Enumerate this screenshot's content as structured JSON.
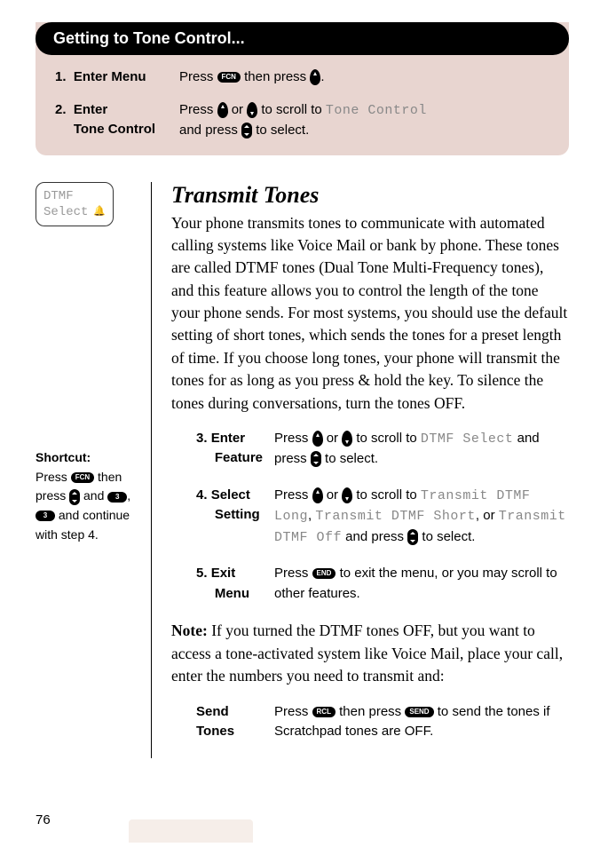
{
  "header": {
    "title": "Getting to Tone Control...",
    "steps": [
      {
        "num": "1.",
        "label": "Enter Menu",
        "desc_parts": [
          "Press ",
          " then press ",
          "."
        ]
      },
      {
        "num": "2.",
        "label_l1": "Enter",
        "label_l2": "Tone Control",
        "desc_p1": "Press ",
        "desc_p2": " or ",
        "desc_p3": " to scroll to ",
        "lcd": "Tone Control",
        "desc_p4": "and press ",
        "desc_p5": " to select."
      }
    ]
  },
  "keys": {
    "fcn": "FCN",
    "end": "END",
    "rcl": "RCL",
    "send": "SEND",
    "three": "3"
  },
  "phone_screen": {
    "line1": "DTMF",
    "line2": "Select"
  },
  "shortcut": {
    "title": "Shortcut:",
    "p1": "Press ",
    "p2": " then press ",
    "p3": " and ",
    "p4": ", ",
    "p5": " and continue with step 4."
  },
  "section_title": "Transmit Tones",
  "body": "Your phone transmits tones to communicate with automated calling systems like Voice Mail or bank by phone. These tones are called DTMF tones (Dual Tone Multi-Frequency tones), and this feature allows you to control the length of the tone your phone sends. For most systems, you should use the default setting of short tones, which sends the tones for a preset length of time. If you choose long tones, your phone will transmit the tones for as long as you press & hold the key. To silence the tones during conversations, turn the tones OFF.",
  "steps": {
    "s3": {
      "num": "3.",
      "l1": "Enter",
      "l2": "Feature",
      "p1": "Press ",
      "p2": " or ",
      "p3": " to scroll to ",
      "lcd": "DTMF Select",
      "p4": " and press ",
      "p5": " to select."
    },
    "s4": {
      "num": "4.",
      "l1": "Select",
      "l2": "Setting",
      "p1": "Press ",
      "p2": " or ",
      "p3": " to scroll to ",
      "lcd1": "Transmit DTMF Long",
      "sep1": ", ",
      "lcd2": "Transmit DTMF Short",
      "sep2": ", or ",
      "lcd3": "Transmit DTMF Off",
      "p4": " and press ",
      "p5": " to select."
    },
    "s5": {
      "num": "5.",
      "l1": "Exit",
      "l2": "Menu",
      "p1": "Press ",
      "p2": " to exit the menu, or you may scroll to other features."
    }
  },
  "note": {
    "label": "Note:",
    "text": " If you turned the DTMF tones OFF, but you want to access a tone-activated system like Voice Mail, place your call, enter the numbers you need to transmit and:"
  },
  "send_tones": {
    "l1": "Send",
    "l2": "Tones",
    "p1": "Press ",
    "p2": " then press ",
    "p3": " to send the tones if Scratchpad tones are OFF."
  },
  "page_number": "76"
}
